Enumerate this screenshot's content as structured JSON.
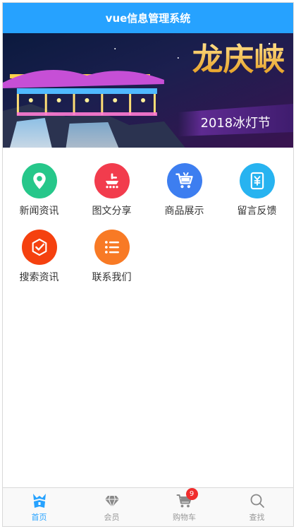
{
  "colors": {
    "primary": "#26a2ff"
  },
  "header": {
    "title": "vue信息管理系统"
  },
  "banner": {
    "title": "龙庆峡",
    "subtitle": "2018冰灯节"
  },
  "grid": {
    "items": [
      {
        "label": "新闻资讯",
        "icon": "location-pin-icon",
        "color": "#26c78a"
      },
      {
        "label": "图文分享",
        "icon": "dianping-icon",
        "color": "#f23c4d"
      },
      {
        "label": "商品展示",
        "icon": "shopping-cart-icon",
        "color": "#3d7ef0"
      },
      {
        "label": "留言反馈",
        "icon": "yuan-card-icon",
        "color": "#27b3f0"
      },
      {
        "label": "搜索资讯",
        "icon": "check-shield-icon",
        "color": "#f5410f"
      },
      {
        "label": "联系我们",
        "icon": "list-icon",
        "color": "#f87a25"
      }
    ]
  },
  "tabbar": {
    "tabs": [
      {
        "label": "首页",
        "icon": "home-icon",
        "active": true
      },
      {
        "label": "会员",
        "icon": "vip-diamond-icon",
        "active": false
      },
      {
        "label": "购物车",
        "icon": "cart-icon",
        "active": false,
        "badge": "9"
      },
      {
        "label": "查找",
        "icon": "search-icon",
        "active": false
      }
    ]
  }
}
